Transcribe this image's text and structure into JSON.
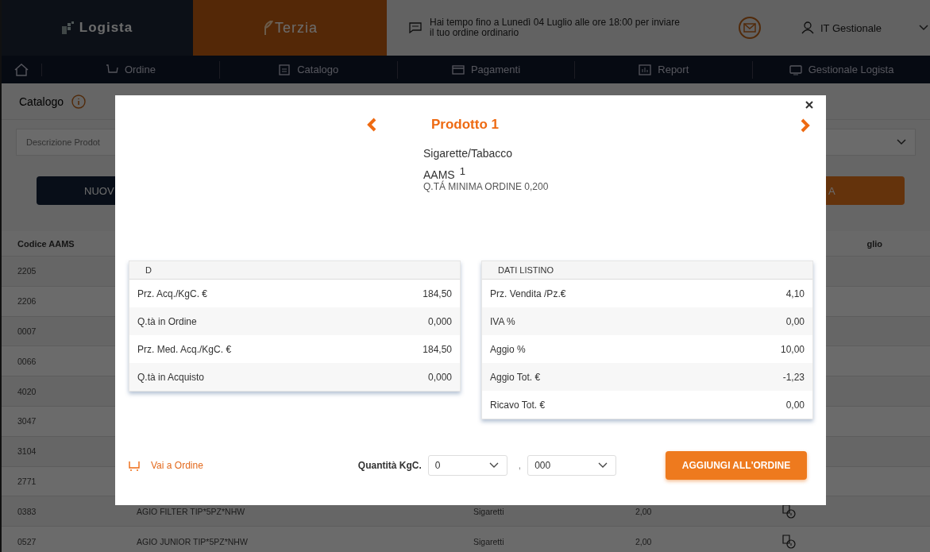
{
  "header": {
    "logo": "Logista",
    "partner_logo": "Terzia",
    "notice": "Hai tempo fino a Lunedì 04 Luglio alle ore 18:00 per inviare il tuo ordine ordinario",
    "user": "IT Gestionale"
  },
  "nav": [
    {
      "kind": "cart",
      "label": "Ordine"
    },
    {
      "kind": "list",
      "label": "Catalogo"
    },
    {
      "kind": "card",
      "label": "Pagamenti"
    },
    {
      "kind": "chart",
      "label": "Report"
    },
    {
      "kind": "monitor",
      "label": "Gestionale Logista"
    }
  ],
  "page": {
    "title": "Catalogo",
    "search_placeholder": "Descrizione Prodot",
    "new_button": "NUOV",
    "action_button": "A",
    "columns": [
      "Codice AAMS",
      "glio"
    ],
    "rows": [
      {
        "code": "2205"
      },
      {
        "code": "2206"
      },
      {
        "code": "0007"
      },
      {
        "code": "0066"
      },
      {
        "code": "4020"
      },
      {
        "code": "3047"
      },
      {
        "code": "3104"
      },
      {
        "code": "2771"
      },
      {
        "code": "0383",
        "name": "AGIO FILTER TIP*5PZ*NHW",
        "category": "Sigaretti",
        "value": "2,00"
      },
      {
        "code": "0527",
        "name": "AGIO JUNIOR TIP*5PZ*NHW",
        "category": "Sigaretti",
        "value": "2,00"
      }
    ]
  },
  "modal": {
    "title": "Prodotto 1",
    "category": "Sigarette/Tabacco",
    "code_label": "AAMS",
    "code": "1",
    "min_order": "Q.TÁ MINIMA ORDINE 0,200",
    "tables": [
      {
        "heading": "D",
        "rows": [
          {
            "label": "Prz. Acq./KgC. €",
            "value": "184,50"
          },
          {
            "label": "Q.tà in Ordine",
            "value": "0,000"
          },
          {
            "label": "Prz. Med. Acq./KgC. €",
            "value": "184,50"
          },
          {
            "label": "Q.tà in Acquisto",
            "value": "0,000"
          }
        ]
      },
      {
        "heading": "DATI LISTINO",
        "rows": [
          {
            "label": "Prz. Vendita /Pz.€",
            "value": "4,10"
          },
          {
            "label": "IVA %",
            "value": "0,00"
          },
          {
            "label": "Aggio %",
            "value": "10,00"
          },
          {
            "label": "Aggio Tot. €",
            "value": "-1,23"
          },
          {
            "label": "Ricavo Tot. €",
            "value": "0,00"
          }
        ]
      }
    ],
    "order_link": "Vai a Ordine",
    "quantity_label": "Quantità KgC.",
    "integer_value": "0",
    "separator": ",",
    "decimal_value": "000",
    "add_button": "AGGIUNGI ALL'ORDINE"
  }
}
